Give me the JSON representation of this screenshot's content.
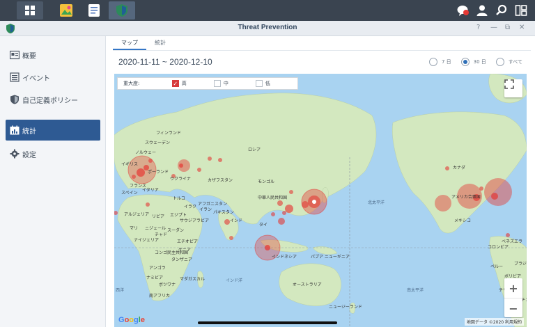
{
  "window_title": "Threat Prevention",
  "sidebar": {
    "items": [
      {
        "label": "概要",
        "icon": "overview-icon"
      },
      {
        "label": "イベント",
        "icon": "list-icon"
      },
      {
        "label": "自己定義ポリシー",
        "icon": "shield-icon"
      },
      {
        "label": "統計",
        "icon": "calendar-stats-icon",
        "active": true
      },
      {
        "label": "設定",
        "icon": "gear-icon"
      }
    ]
  },
  "tabs": [
    {
      "label": "マップ",
      "active": true
    },
    {
      "label": "統計"
    }
  ],
  "date_range": "2020-11-11 ~ 2020-12-10",
  "period_options": [
    {
      "label": "7 日",
      "selected": false
    },
    {
      "label": "30 日",
      "selected": true
    },
    {
      "label": "すべて",
      "selected": false
    }
  ],
  "severity": {
    "label": "重大度:",
    "options": [
      {
        "label": "高",
        "checked": true
      },
      {
        "label": "中",
        "checked": false
      },
      {
        "label": "低",
        "checked": false
      }
    ]
  },
  "map_labels": [
    "フィンランド",
    "スウェーデン",
    "ノルウェー",
    "イギリス",
    "ポーランド",
    "ウクライナ",
    "フランス",
    "スペイン",
    "イタリア",
    "トルコ",
    "イラク",
    "イラン",
    "アルジェリア",
    "リビア",
    "エジプト",
    "サウジアラビア",
    "マリ",
    "ニジェール",
    "チャド",
    "スーダン",
    "ナイジェリア",
    "エチオピア",
    "コンゴ民主共和国",
    "ケニア",
    "タンザニア",
    "アンゴラ",
    "ナミビア",
    "ボツワナ",
    "マダガスカル",
    "南アフリカ",
    "カザフスタン",
    "モンゴル",
    "ロシア",
    "アフガニスタン",
    "パキスタン",
    "インド",
    "中華人民共和国",
    "タイ",
    "インドネシア",
    "パプア ニューギニア",
    "オーストラリア",
    "ニュージーランド",
    "カナダ",
    "アメリカ合衆国",
    "メキシコ",
    "ベネズエラ",
    "コロンビア",
    "ペルー",
    "ボリビア",
    "ブラジル",
    "チリ",
    "アルゼンチン"
  ],
  "ocean_labels": [
    "北太平洋",
    "南太平洋",
    "インド洋",
    "西洋"
  ],
  "attribution": "地図データ ©2020  利用規約",
  "google_logo": "Google",
  "colors": {
    "accent": "#2e5a93",
    "threat_marker": "#e53935",
    "ocean": "#a9d3f1",
    "land": "#cfe6b8"
  }
}
